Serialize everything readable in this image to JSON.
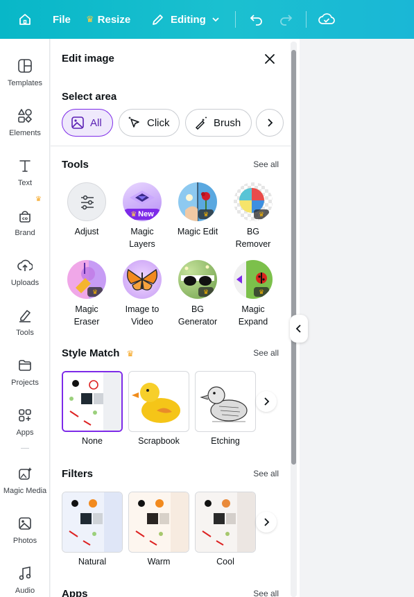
{
  "topbar": {
    "file_label": "File",
    "resize_label": "Resize",
    "editing_label": "Editing"
  },
  "rail": {
    "items": [
      {
        "label": "Templates",
        "icon": "templates-icon"
      },
      {
        "label": "Elements",
        "icon": "elements-icon"
      },
      {
        "label": "Text",
        "icon": "text-icon"
      },
      {
        "label": "Brand",
        "icon": "brand-icon"
      },
      {
        "label": "Uploads",
        "icon": "uploads-icon"
      },
      {
        "label": "Tools",
        "icon": "tools-icon"
      },
      {
        "label": "Projects",
        "icon": "projects-icon"
      },
      {
        "label": "Apps",
        "icon": "apps-icon"
      },
      {
        "label": "Magic Media",
        "icon": "magic-media-icon"
      },
      {
        "label": "Photos",
        "icon": "photos-icon"
      },
      {
        "label": "Audio",
        "icon": "audio-icon"
      }
    ]
  },
  "panel": {
    "title": "Edit image",
    "select_area": {
      "title": "Select area",
      "options": [
        "All",
        "Click",
        "Brush"
      ]
    },
    "tools": {
      "title": "Tools",
      "see_all": "See all",
      "new_badge": "New",
      "items": [
        "Adjust",
        "Magic Layers",
        "Magic Edit",
        "BG Remover",
        "Magic Eraser",
        "Image to Video",
        "BG Generator",
        "Magic Expand"
      ]
    },
    "style_match": {
      "title": "Style Match",
      "see_all": "See all",
      "items": [
        "None",
        "Scrapbook",
        "Etching"
      ]
    },
    "filters": {
      "title": "Filters",
      "see_all": "See all",
      "items": [
        "Natural",
        "Warm",
        "Cool"
      ]
    },
    "apps": {
      "title": "Apps",
      "see_all": "See all"
    }
  },
  "colors": {
    "accent": "#7d2ae8",
    "topbar": "#1bc0d0",
    "crown": "#f5b301"
  }
}
